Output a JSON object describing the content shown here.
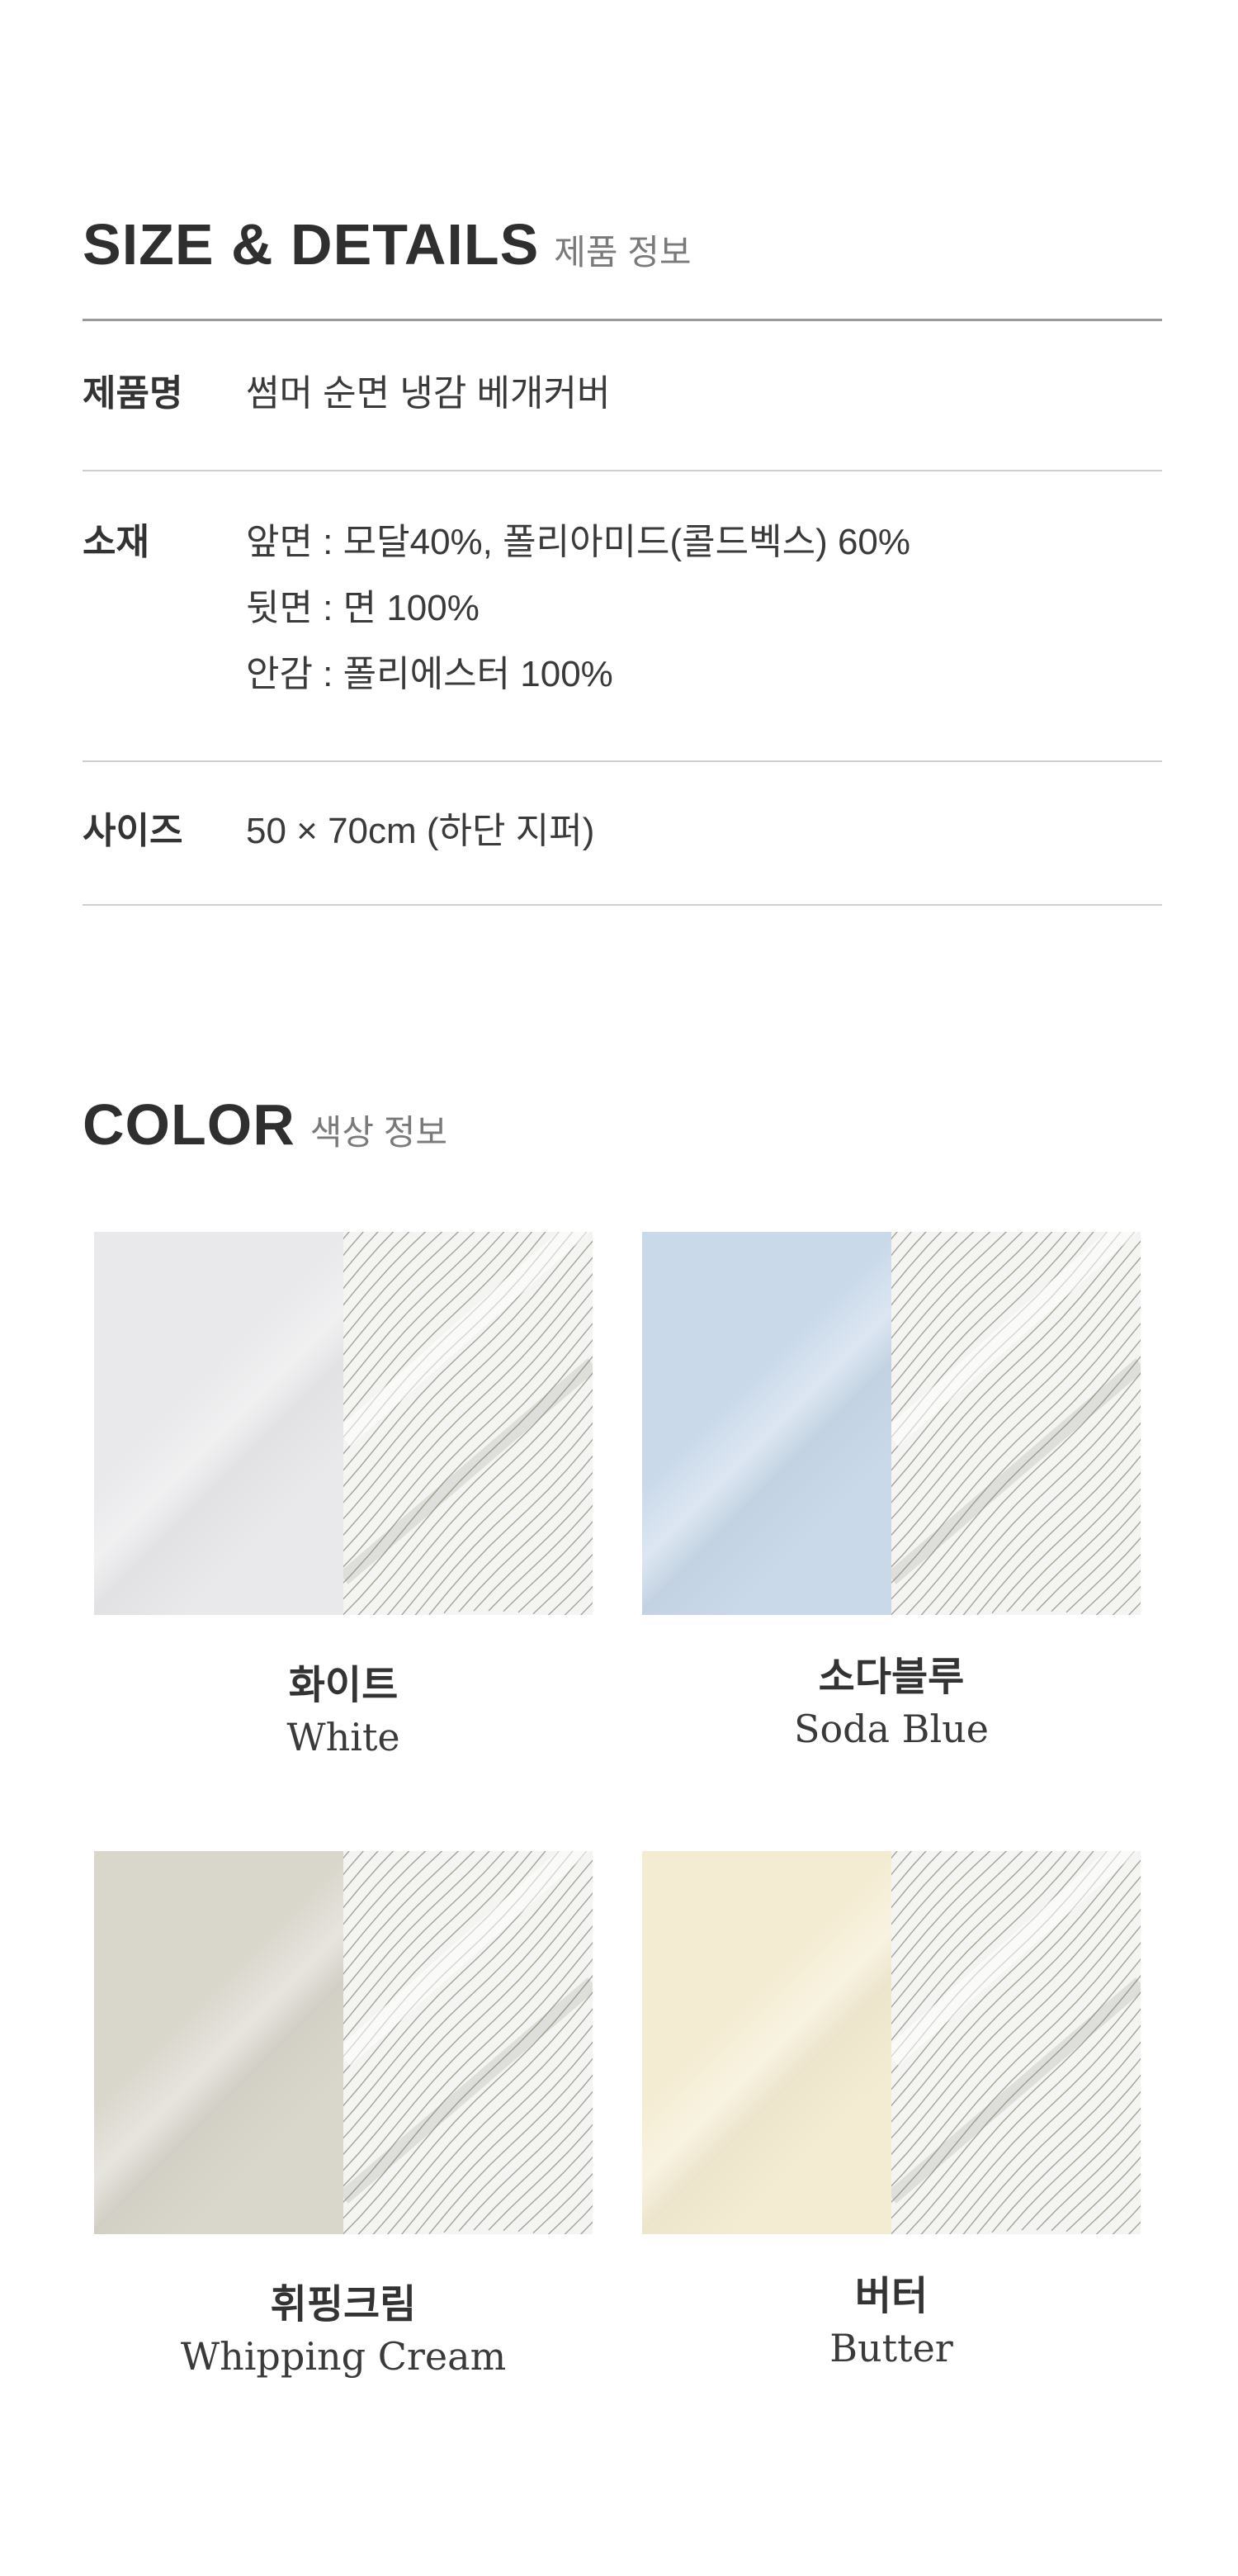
{
  "size_section": {
    "title_en": "SIZE & DETAILS",
    "title_ko": "제품 정보",
    "rows": [
      {
        "label": "제품명",
        "lines": [
          "썸머 순면 냉감 베개커버"
        ]
      },
      {
        "label": "소재",
        "lines": [
          "앞면 : 모달40%, 폴리아미드(콜드벡스) 60%",
          "뒷면 : 면 100%",
          "안감 : 폴리에스터 100%"
        ]
      },
      {
        "label": "사이즈",
        "lines": [
          "50 × 70cm (하단 지퍼)"
        ]
      }
    ]
  },
  "color_section": {
    "title_en": "COLOR",
    "title_ko": "색상 정보",
    "swatches": [
      {
        "name_ko": "화이트",
        "name_en": "White",
        "color": "#e9e8ea",
        "stripe_color": "#8a8878"
      },
      {
        "name_ko": "소다블루",
        "name_en": "Soda Blue",
        "color": "#c9d9ea",
        "stripe_color": "#8a8878"
      },
      {
        "name_ko": "휘핑크림",
        "name_en": "Whipping Cream",
        "color": "#d9d6cc",
        "stripe_color": "#8a8878"
      },
      {
        "name_ko": "버터",
        "name_en": "Butter",
        "color": "#f4ecd2",
        "stripe_color": "#8a8878"
      }
    ]
  }
}
